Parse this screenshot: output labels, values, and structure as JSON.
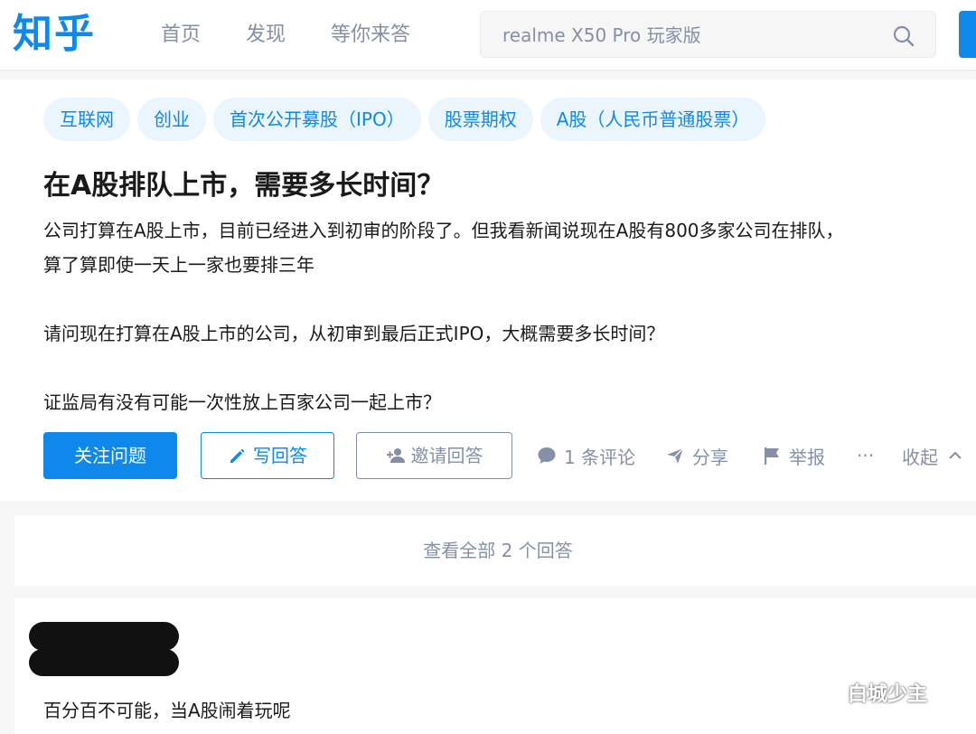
{
  "header": {
    "logo": "知乎",
    "nav": [
      "首页",
      "发现",
      "等你来答"
    ],
    "search_value": "realme X50 Pro 玩家版"
  },
  "question": {
    "topics": [
      "互联网",
      "创业",
      "首次公开募股（IPO）",
      "股票期权",
      "A股（人民币普通股票）"
    ],
    "title": "在A股排队上市，需要多长时间？",
    "body_lines": [
      "公司打算在A股上市，目前已经进入到初审的阶段了。但我看新闻说现在A股有800多家公司在排队，",
      "算了算即使一天上一家也要排三年",
      "",
      "请问现在打算在A股上市的公司，从初审到最后正式IPO，大概需要多长时间？",
      "",
      "证监局有没有可能一次性放上百家公司一起上市？"
    ],
    "actions": {
      "follow": "关注问题",
      "write_answer": "写回答",
      "invite": "邀请回答",
      "comments": "1 条评论",
      "share": "分享",
      "report": "举报",
      "more": "···",
      "collapse": "收起"
    }
  },
  "view_all_answers": "查看全部 2 个回答",
  "answer": {
    "text": "百分百不可能，当A股闹着玩呢"
  },
  "watermark": "白城少主",
  "colors": {
    "brand": "#0f88eb",
    "muted": "#8590a6",
    "topic_bg": "#ebf5fd"
  }
}
